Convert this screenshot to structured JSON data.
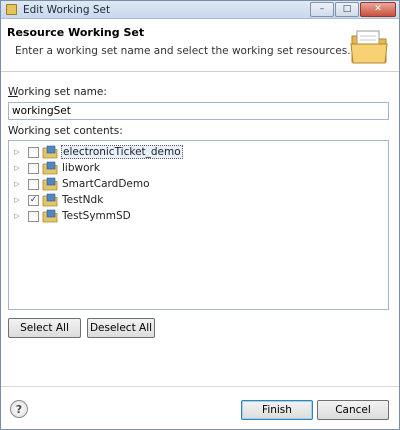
{
  "window": {
    "title": "Edit Working Set",
    "controls": {
      "minimize": "–",
      "maximize": "□",
      "close": "✕"
    }
  },
  "banner": {
    "title": "Resource Working Set",
    "description": "Enter a working set name and select the working set resources.",
    "icon": "folder-icon"
  },
  "form": {
    "name_label_mnemonic": "W",
    "name_label_rest": "orking set name:",
    "name_value": "workingSet",
    "contents_label": "Working set contents:"
  },
  "tree": {
    "items": [
      {
        "label": "electronicTicket_demo",
        "checked": false,
        "focused": true,
        "icon": "java-project-icon"
      },
      {
        "label": "libwork",
        "checked": false,
        "focused": false,
        "icon": "java-project-icon"
      },
      {
        "label": "SmartCardDemo",
        "checked": false,
        "focused": false,
        "icon": "java-project-icon"
      },
      {
        "label": "TestNdk",
        "checked": true,
        "focused": false,
        "icon": "java-project-icon"
      },
      {
        "label": "TestSymmSD",
        "checked": false,
        "focused": false,
        "icon": "java-project-icon"
      }
    ]
  },
  "buttons": {
    "select_all": "Select All",
    "deselect_all": "Deselect All",
    "finish": "Finish",
    "cancel": "Cancel",
    "help": "?"
  }
}
